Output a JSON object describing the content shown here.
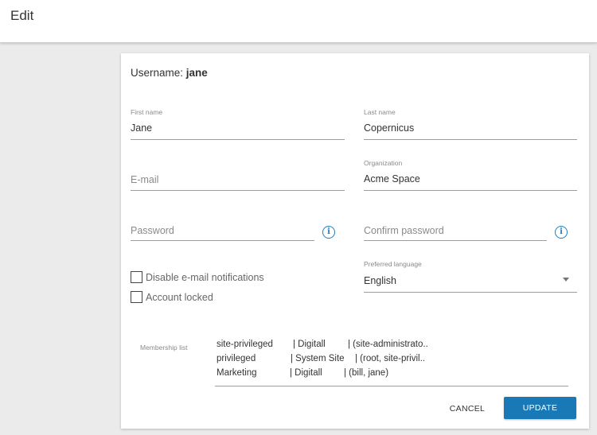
{
  "header": {
    "title": "Edit"
  },
  "user": {
    "username_label": "Username:",
    "username": "jane"
  },
  "fields": {
    "first_name": {
      "label": "First name",
      "value": "Jane"
    },
    "last_name": {
      "label": "Last name",
      "value": "Copernicus"
    },
    "email": {
      "placeholder": "E-mail",
      "value": ""
    },
    "organization": {
      "label": "Organization",
      "value": "Acme Space"
    },
    "password": {
      "placeholder": "Password"
    },
    "confirm_password": {
      "placeholder": "Confirm password"
    },
    "preferred_language": {
      "label": "Preferred language",
      "value": "English"
    }
  },
  "checkboxes": {
    "disable_email": {
      "label": "Disable e-mail notifications",
      "checked": false
    },
    "account_locked": {
      "label": "Account locked",
      "checked": false
    }
  },
  "membership": {
    "label": "Membership list",
    "rows": [
      {
        "group": "site-privileged",
        "site": "| Digitall",
        "members": "| (site-administrato.."
      },
      {
        "group": "privileged",
        "site": "| System Site",
        "members": "| (root, site-privil.."
      },
      {
        "group": "Marketing",
        "site": "| Digitall",
        "members": "| (bill, jane)"
      }
    ]
  },
  "actions": {
    "cancel": "CANCEL",
    "update": "UPDATE"
  },
  "icons": {
    "info": "info-icon",
    "dropdown": "chevron-down-icon"
  },
  "colors": {
    "accent": "#1879b6",
    "background": "#ebebeb"
  }
}
